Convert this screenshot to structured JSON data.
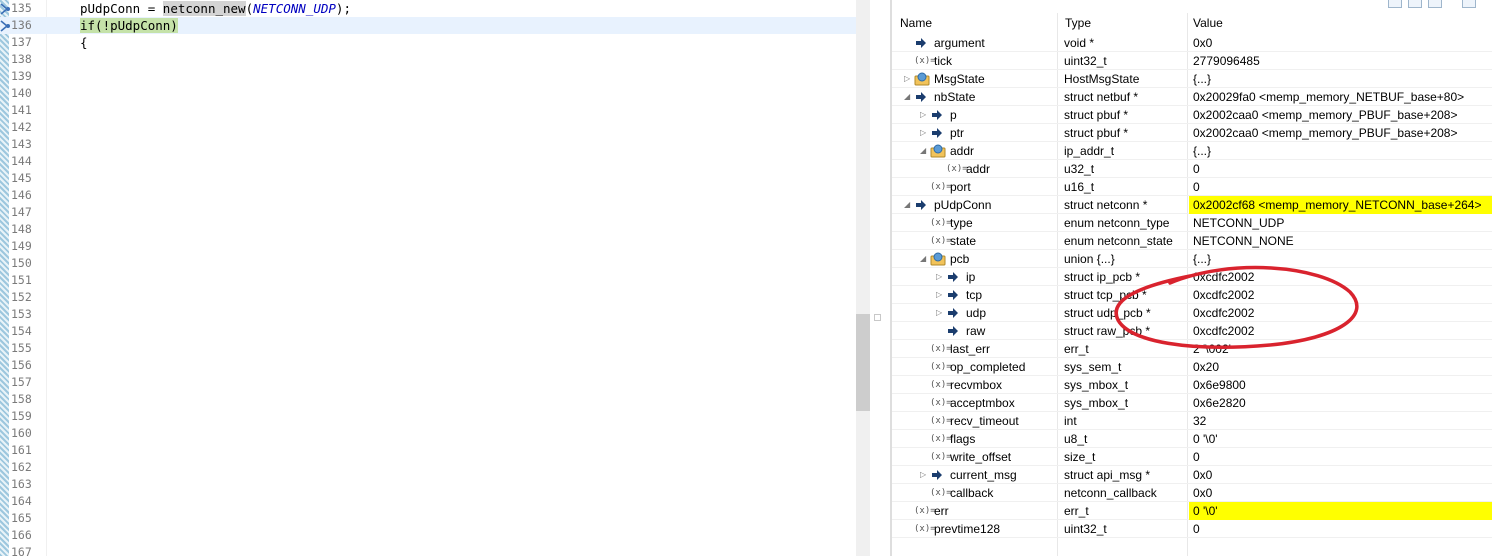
{
  "editor": {
    "lines": [
      {
        "num": "135",
        "code": [
          {
            "t": "pUdpConn = "
          },
          {
            "t": "netconn_new",
            "cls": "hl-call"
          },
          {
            "t": "("
          },
          {
            "t": "NETCONN_UDP",
            "cls": "const"
          },
          {
            "t": ");"
          }
        ],
        "mark": "breakpoint-arrow"
      },
      {
        "num": "136",
        "code": [
          {
            "t": "if(!pUdpConn)",
            "cls": "hl-stmt"
          }
        ],
        "current": true,
        "mark": "instruction-pointer"
      },
      {
        "num": "137",
        "code": [
          {
            "t": "{"
          }
        ]
      },
      {
        "num": "138",
        "code": []
      },
      {
        "num": "139",
        "code": []
      },
      {
        "num": "140",
        "code": []
      },
      {
        "num": "141",
        "code": []
      },
      {
        "num": "142",
        "code": []
      },
      {
        "num": "143",
        "code": []
      },
      {
        "num": "144",
        "code": []
      },
      {
        "num": "145",
        "code": []
      },
      {
        "num": "146",
        "code": []
      },
      {
        "num": "147",
        "code": []
      },
      {
        "num": "148",
        "code": []
      },
      {
        "num": "149",
        "code": []
      },
      {
        "num": "150",
        "code": []
      },
      {
        "num": "151",
        "code": []
      },
      {
        "num": "152",
        "code": []
      },
      {
        "num": "153",
        "code": []
      },
      {
        "num": "154",
        "code": []
      },
      {
        "num": "155",
        "code": []
      },
      {
        "num": "156",
        "code": []
      },
      {
        "num": "157",
        "code": []
      },
      {
        "num": "158",
        "code": []
      },
      {
        "num": "159",
        "code": []
      },
      {
        "num": "160",
        "code": []
      },
      {
        "num": "161",
        "code": []
      },
      {
        "num": "162",
        "code": []
      },
      {
        "num": "163",
        "code": []
      },
      {
        "num": "164",
        "code": []
      },
      {
        "num": "165",
        "code": []
      },
      {
        "num": "166",
        "code": []
      },
      {
        "num": "167",
        "code": []
      }
    ]
  },
  "variables": {
    "headers": {
      "name": "Name",
      "type": "Type",
      "value": "Value"
    },
    "rows": [
      {
        "depth": 0,
        "twisty": "",
        "icon": "pointer",
        "name": "argument",
        "type": "void *",
        "value": "0x0"
      },
      {
        "depth": 0,
        "twisty": "",
        "icon": "variable",
        "name": "tick",
        "type": "uint32_t",
        "value": "2779096485"
      },
      {
        "depth": 0,
        "twisty": "collapsed",
        "icon": "struct",
        "name": "MsgState",
        "type": "HostMsgState",
        "value": "{...}"
      },
      {
        "depth": 0,
        "twisty": "expanded",
        "icon": "pointer",
        "name": "nbState",
        "type": "struct netbuf *",
        "value": "0x20029fa0 <memp_memory_NETBUF_base+80>"
      },
      {
        "depth": 1,
        "twisty": "collapsed",
        "icon": "pointer",
        "name": "p",
        "type": "struct pbuf *",
        "value": "0x2002caa0 <memp_memory_PBUF_base+208>"
      },
      {
        "depth": 1,
        "twisty": "collapsed",
        "icon": "pointer",
        "name": "ptr",
        "type": "struct pbuf *",
        "value": "0x2002caa0 <memp_memory_PBUF_base+208>"
      },
      {
        "depth": 1,
        "twisty": "expanded",
        "icon": "struct",
        "name": "addr",
        "type": "ip_addr_t",
        "value": "{...}"
      },
      {
        "depth": 2,
        "twisty": "",
        "icon": "variable",
        "name": "addr",
        "type": "u32_t",
        "value": "0"
      },
      {
        "depth": 1,
        "twisty": "",
        "icon": "variable",
        "name": "port",
        "type": "u16_t",
        "value": "0"
      },
      {
        "depth": 0,
        "twisty": "expanded",
        "icon": "pointer",
        "name": "pUdpConn",
        "type": "struct netconn *",
        "value": "0x2002cf68 <memp_memory_NETCONN_base+264>",
        "changed": true
      },
      {
        "depth": 1,
        "twisty": "",
        "icon": "variable",
        "name": "type",
        "type": "enum netconn_type",
        "value": "NETCONN_UDP"
      },
      {
        "depth": 1,
        "twisty": "",
        "icon": "variable",
        "name": "state",
        "type": "enum netconn_state",
        "value": "NETCONN_NONE"
      },
      {
        "depth": 1,
        "twisty": "expanded",
        "icon": "struct",
        "name": "pcb",
        "type": "union {...}",
        "value": "{...}"
      },
      {
        "depth": 2,
        "twisty": "collapsed",
        "icon": "pointer",
        "name": "ip",
        "type": "struct ip_pcb *",
        "value": "0xcdfc2002"
      },
      {
        "depth": 2,
        "twisty": "collapsed",
        "icon": "pointer",
        "name": "tcp",
        "type": "struct tcp_pcb *",
        "value": "0xcdfc2002"
      },
      {
        "depth": 2,
        "twisty": "collapsed",
        "icon": "pointer",
        "name": "udp",
        "type": "struct udp_pcb *",
        "value": "0xcdfc2002"
      },
      {
        "depth": 2,
        "twisty": "",
        "icon": "pointer",
        "name": "raw",
        "type": "struct raw_pcb *",
        "value": "0xcdfc2002"
      },
      {
        "depth": 1,
        "twisty": "",
        "icon": "variable",
        "name": "last_err",
        "type": "err_t",
        "value": "2 '\\002'"
      },
      {
        "depth": 1,
        "twisty": "",
        "icon": "variable",
        "name": "op_completed",
        "type": "sys_sem_t",
        "value": "0x20"
      },
      {
        "depth": 1,
        "twisty": "",
        "icon": "variable",
        "name": "recvmbox",
        "type": "sys_mbox_t",
        "value": "0x6e9800"
      },
      {
        "depth": 1,
        "twisty": "",
        "icon": "variable",
        "name": "acceptmbox",
        "type": "sys_mbox_t",
        "value": "0x6e2820"
      },
      {
        "depth": 1,
        "twisty": "",
        "icon": "variable",
        "name": "recv_timeout",
        "type": "int",
        "value": "32"
      },
      {
        "depth": 1,
        "twisty": "",
        "icon": "variable",
        "name": "flags",
        "type": "u8_t",
        "value": "0 '\\0'"
      },
      {
        "depth": 1,
        "twisty": "",
        "icon": "variable",
        "name": "write_offset",
        "type": "size_t",
        "value": "0"
      },
      {
        "depth": 1,
        "twisty": "collapsed",
        "icon": "pointer",
        "name": "current_msg",
        "type": "struct api_msg *",
        "value": "0x0"
      },
      {
        "depth": 1,
        "twisty": "",
        "icon": "variable",
        "name": "callback",
        "type": "netconn_callback",
        "value": "0x0"
      },
      {
        "depth": 0,
        "twisty": "",
        "icon": "variable",
        "name": "err",
        "type": "err_t",
        "value": "0 '\\0'",
        "changed": true
      },
      {
        "depth": 0,
        "twisty": "",
        "icon": "variable",
        "name": "prevtime128",
        "type": "uint32_t",
        "value": "0"
      }
    ]
  },
  "icons": {
    "variable": "(x)=",
    "pointer": "arrow-right-icon",
    "struct": "struct-icon"
  },
  "colors": {
    "changed": "#ffff00",
    "current_line": "#e8f2fe",
    "stmt_highlight": "#c5e2a9",
    "annotation_circle": "#d9232e",
    "pointer_icon": "#1b3d6e"
  }
}
